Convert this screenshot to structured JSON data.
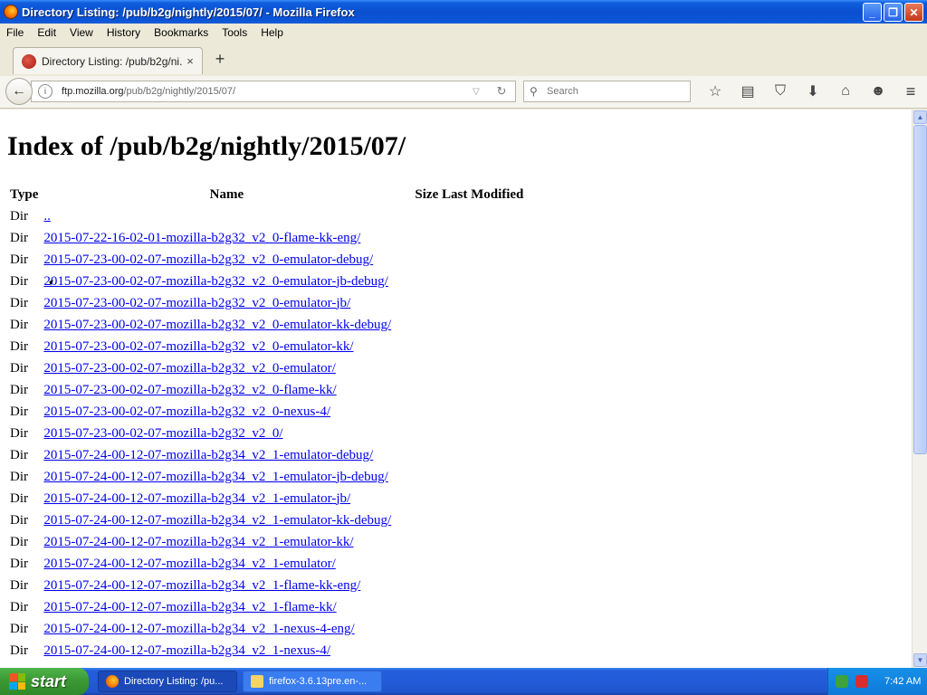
{
  "window": {
    "title": "Directory Listing: /pub/b2g/nightly/2015/07/ - Mozilla Firefox",
    "min_glyph": "_",
    "max_glyph": "❐",
    "close_glyph": "✕"
  },
  "menubar": [
    "File",
    "Edit",
    "View",
    "History",
    "Bookmarks",
    "Tools",
    "Help"
  ],
  "tab": {
    "label": "Directory Listing: /pub/b2g/ni...",
    "close_glyph": "×",
    "newtab_glyph": "+"
  },
  "navbar": {
    "back_glyph": "←",
    "info_glyph": "i",
    "url_host": "ftp.mozilla.org",
    "url_path": "/pub/b2g/nightly/2015/07/",
    "drop_glyph": "▽",
    "reload_glyph": "↻",
    "search_placeholder": "Search",
    "search_glyph": "⚲",
    "icons": [
      {
        "name": "bookmark-star-icon",
        "glyph": "☆"
      },
      {
        "name": "reading-list-icon",
        "glyph": "▤"
      },
      {
        "name": "pocket-icon",
        "glyph": "⛉"
      },
      {
        "name": "downloads-icon",
        "glyph": "⬇"
      },
      {
        "name": "home-icon",
        "glyph": "⌂"
      },
      {
        "name": "hello-icon",
        "glyph": "☻"
      }
    ],
    "menu_glyph": "≡"
  },
  "page": {
    "heading": "Index of /pub/b2g/nightly/2015/07/",
    "columns": {
      "type": "Type",
      "name": "Name",
      "size_modified": "Size Last Modified"
    },
    "rows": [
      {
        "type": "Dir",
        "name": ".."
      },
      {
        "type": "Dir",
        "name": "2015-07-22-16-02-01-mozilla-b2g32_v2_0-flame-kk-eng/"
      },
      {
        "type": "Dir",
        "name": "2015-07-23-00-02-07-mozilla-b2g32_v2_0-emulator-debug/"
      },
      {
        "type": "Dir",
        "name": "2015-07-23-00-02-07-mozilla-b2g32_v2_0-emulator-jb-debug/"
      },
      {
        "type": "Dir",
        "name": "2015-07-23-00-02-07-mozilla-b2g32_v2_0-emulator-jb/"
      },
      {
        "type": "Dir",
        "name": "2015-07-23-00-02-07-mozilla-b2g32_v2_0-emulator-kk-debug/"
      },
      {
        "type": "Dir",
        "name": "2015-07-23-00-02-07-mozilla-b2g32_v2_0-emulator-kk/"
      },
      {
        "type": "Dir",
        "name": "2015-07-23-00-02-07-mozilla-b2g32_v2_0-emulator/"
      },
      {
        "type": "Dir",
        "name": "2015-07-23-00-02-07-mozilla-b2g32_v2_0-flame-kk/"
      },
      {
        "type": "Dir",
        "name": "2015-07-23-00-02-07-mozilla-b2g32_v2_0-nexus-4/"
      },
      {
        "type": "Dir",
        "name": "2015-07-23-00-02-07-mozilla-b2g32_v2_0/"
      },
      {
        "type": "Dir",
        "name": "2015-07-24-00-12-07-mozilla-b2g34_v2_1-emulator-debug/"
      },
      {
        "type": "Dir",
        "name": "2015-07-24-00-12-07-mozilla-b2g34_v2_1-emulator-jb-debug/"
      },
      {
        "type": "Dir",
        "name": "2015-07-24-00-12-07-mozilla-b2g34_v2_1-emulator-jb/"
      },
      {
        "type": "Dir",
        "name": "2015-07-24-00-12-07-mozilla-b2g34_v2_1-emulator-kk-debug/"
      },
      {
        "type": "Dir",
        "name": "2015-07-24-00-12-07-mozilla-b2g34_v2_1-emulator-kk/"
      },
      {
        "type": "Dir",
        "name": "2015-07-24-00-12-07-mozilla-b2g34_v2_1-emulator/"
      },
      {
        "type": "Dir",
        "name": "2015-07-24-00-12-07-mozilla-b2g34_v2_1-flame-kk-eng/"
      },
      {
        "type": "Dir",
        "name": "2015-07-24-00-12-07-mozilla-b2g34_v2_1-flame-kk/"
      },
      {
        "type": "Dir",
        "name": "2015-07-24-00-12-07-mozilla-b2g34_v2_1-nexus-4-eng/"
      },
      {
        "type": "Dir",
        "name": "2015-07-24-00-12-07-mozilla-b2g34_v2_1-nexus-4/"
      }
    ]
  },
  "scrollbar": {
    "up_glyph": "▲",
    "down_glyph": "▼"
  },
  "taskbar": {
    "start_label": "start",
    "items": [
      {
        "label": "Directory Listing: /pu...",
        "active": true
      },
      {
        "label": "firefox-3.6.13pre.en-...",
        "active": false
      }
    ],
    "clock": "7:42 AM"
  },
  "colors": {
    "link": "#0000ee",
    "titlebar": "#0a4fd0",
    "taskbar": "#225bd8",
    "start_button": "#3c9a35"
  }
}
